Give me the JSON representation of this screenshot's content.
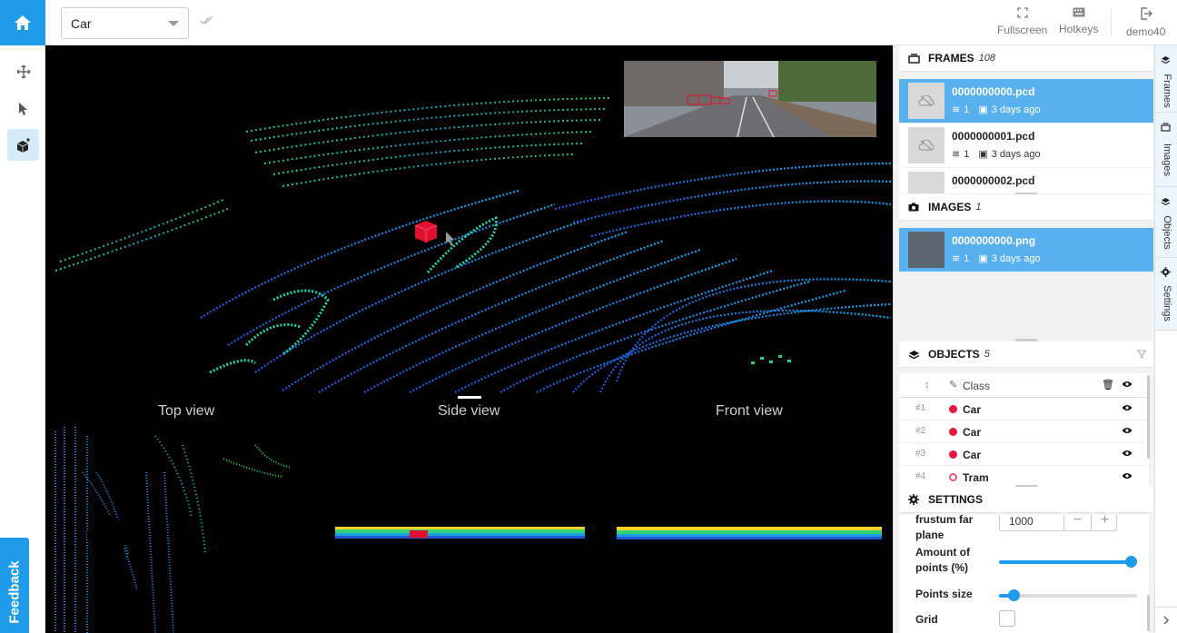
{
  "toolbar": {
    "class_select_value": "Car",
    "fullscreen_label": "Fullscreen",
    "hotkeys_label": "Hotkeys",
    "user_label": "demo40"
  },
  "views": {
    "top": "Top view",
    "side": "Side view",
    "front": "Front view"
  },
  "frames": {
    "title": "FRAMES",
    "count": "108",
    "items": [
      {
        "name": "0000000000.pcd",
        "layers": "1",
        "date": "3 days ago"
      },
      {
        "name": "0000000001.pcd",
        "layers": "1",
        "date": "3 days ago"
      },
      {
        "name": "0000000002.pcd",
        "layers": "",
        "date": ""
      }
    ]
  },
  "images": {
    "title": "IMAGES",
    "count": "1",
    "items": [
      {
        "name": "0000000000.png",
        "layers": "1",
        "date": "3 days ago"
      }
    ]
  },
  "objects": {
    "title": "OBJECTS",
    "count": "5",
    "class_header": "Class",
    "rows": [
      {
        "index": "#1",
        "class": "Car",
        "color": "#e6183c"
      },
      {
        "index": "#2",
        "class": "Car",
        "color": "#e6183c"
      },
      {
        "index": "#3",
        "class": "Car",
        "color": "#e6183c"
      },
      {
        "index": "#4",
        "class": "Tram",
        "color": "#e85a7a"
      }
    ]
  },
  "settings": {
    "title": "SETTINGS",
    "frustum_label_1": "frustum far",
    "frustum_label_2": "plane",
    "frustum_value": "1000",
    "amount_label_1": "Amount of",
    "amount_label_2": "points (%)",
    "amount_value": 1.0,
    "points_size_label": "Points size",
    "points_size_value": 0.07,
    "grid_label": "Grid",
    "grid_checked": false
  },
  "sidetabs": {
    "frames": "Frames",
    "images": "Images",
    "objects": "Objects",
    "settings": "Settings"
  },
  "feedback": "Feedback",
  "colors": {
    "accent": "#1e9be9",
    "selected_row": "#58b0ef",
    "car_class": "#e6183c"
  }
}
